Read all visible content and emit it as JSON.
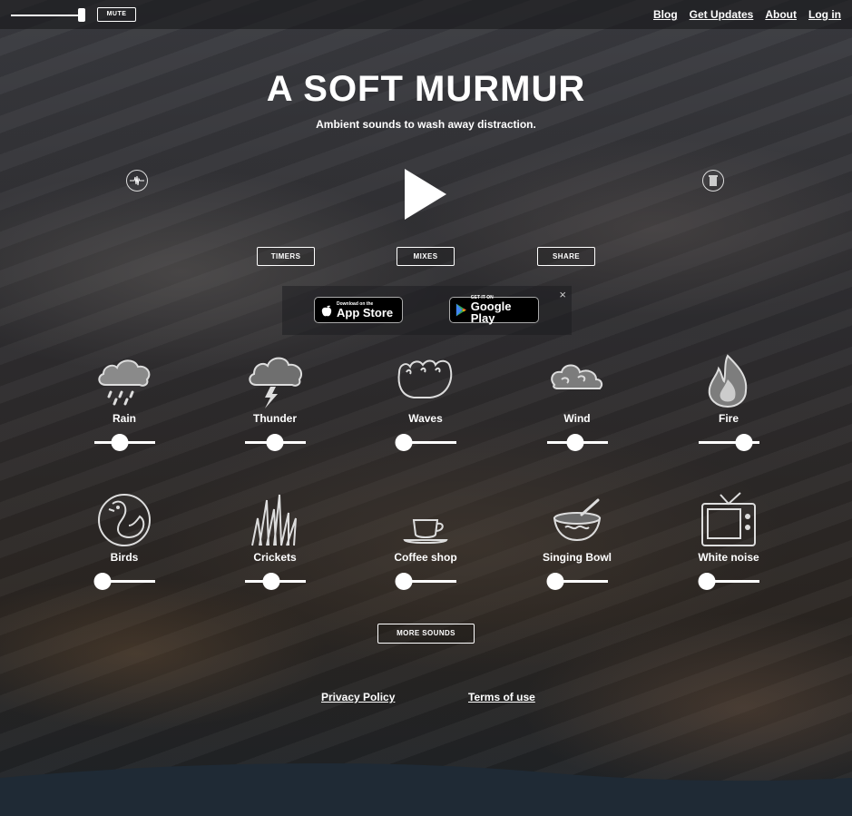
{
  "topbar": {
    "volume_level": 0.95,
    "mute_label": "MUTE",
    "nav": [
      "Blog",
      "Get Updates",
      "About",
      "Log in"
    ]
  },
  "hero": {
    "title": "A SOFT MURMUR",
    "subtitle": "Ambient sounds to wash away distraction."
  },
  "controls": {
    "timers_label": "TIMERS",
    "mixes_label": "MIXES",
    "share_label": "SHARE"
  },
  "store": {
    "close_glyph": "×",
    "appstore_small": "Download on the",
    "appstore_big": "App Store",
    "googleplay_small": "GET IT ON",
    "googleplay_big": "Google Play"
  },
  "sounds": [
    {
      "label": "Rain",
      "icon": "rain-icon",
      "level": 0.4
    },
    {
      "label": "Thunder",
      "icon": "thunder-icon",
      "level": 0.5
    },
    {
      "label": "Waves",
      "icon": "waves-icon",
      "level": 0.0
    },
    {
      "label": "Wind",
      "icon": "wind-icon",
      "level": 0.45
    },
    {
      "label": "Fire",
      "icon": "fire-icon",
      "level": 0.85
    },
    {
      "label": "Birds",
      "icon": "birds-icon",
      "level": 0.0
    },
    {
      "label": "Crickets",
      "icon": "crickets-icon",
      "level": 0.42
    },
    {
      "label": "Coffee shop",
      "icon": "coffee-icon",
      "level": 0.0
    },
    {
      "label": "Singing Bowl",
      "icon": "singing-bowl-icon",
      "level": 0.0
    },
    {
      "label": "White noise",
      "icon": "tv-icon",
      "level": 0.0
    }
  ],
  "more_sounds_label": "MORE SOUNDS",
  "footer": {
    "privacy": "Privacy Policy",
    "terms": "Terms of use"
  }
}
